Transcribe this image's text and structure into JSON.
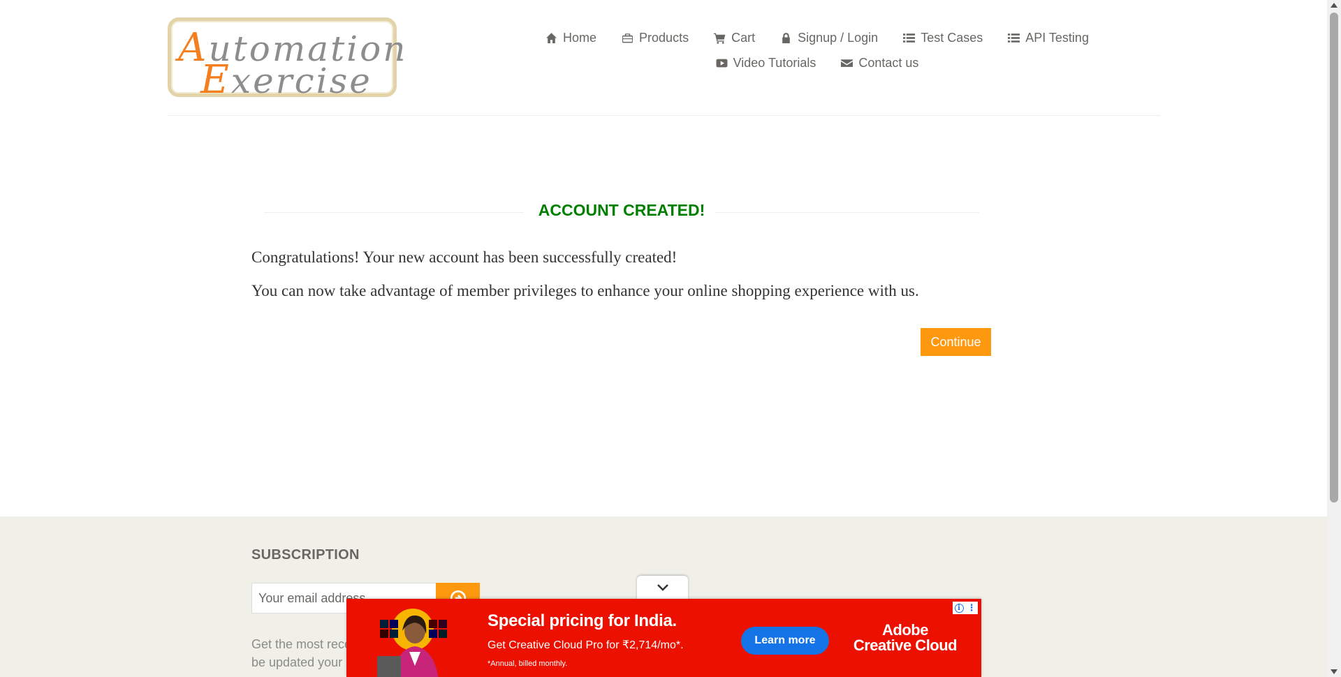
{
  "logo": {
    "line1_cap": "A",
    "line1_rest": "utomation",
    "line2_cap": "E",
    "line2_rest": "xercise"
  },
  "nav": {
    "row1": [
      {
        "icon": "home-icon",
        "label": "Home"
      },
      {
        "icon": "briefcase-icon",
        "label": "Products"
      },
      {
        "icon": "cart-icon",
        "label": "Cart"
      },
      {
        "icon": "lock-icon",
        "label": "Signup / Login"
      },
      {
        "icon": "list-icon",
        "label": "Test Cases"
      },
      {
        "icon": "list-icon",
        "label": "API Testing"
      }
    ],
    "row2": [
      {
        "icon": "youtube-play-icon",
        "label": "Video Tutorials"
      },
      {
        "icon": "envelope-icon",
        "label": "Contact us"
      }
    ]
  },
  "main": {
    "title": "ACCOUNT CREATED!",
    "message1": "Congratulations! Your new account has been successfully created!",
    "message2": "You can now take advantage of member privileges to enhance your online shopping experience with us.",
    "continue_label": "Continue"
  },
  "footer": {
    "subscription_title": "SUBSCRIPTION",
    "email_placeholder": "Your email address",
    "description": "Get the most recent updates from our site and be updated your self..."
  },
  "ad": {
    "headline": "Special pricing for India.",
    "subline": "Get Creative Cloud Pro for ₹2,714/mo*.",
    "note": "*Annual, billed monthly.",
    "cta": "Learn more",
    "brand_line1": "Adobe",
    "brand_line2": "Creative Cloud"
  },
  "colors": {
    "accent": "#fe980f",
    "title_green": "#008000",
    "footer_bg": "#f0f0e9",
    "ad_red": "#eb1000",
    "ad_cta_blue": "#1473e6"
  }
}
